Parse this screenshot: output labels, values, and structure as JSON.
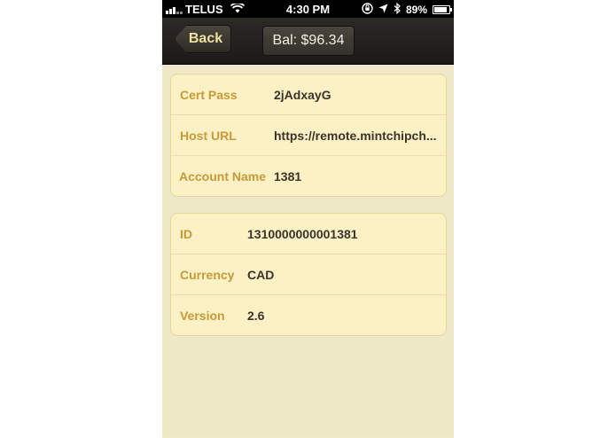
{
  "status_bar": {
    "carrier": "TELUS",
    "time": "4:30 PM",
    "battery": "89%"
  },
  "navbar": {
    "back_label": "Back",
    "balance": "Bal: $96.34"
  },
  "group_one": {
    "rows": [
      {
        "label": "Cert Pass",
        "value": "2jAdxayG"
      },
      {
        "label": "Host URL",
        "value": "https://remote.mintchipch..."
      },
      {
        "label": "Account Name",
        "value": "1381"
      }
    ]
  },
  "group_two": {
    "rows": [
      {
        "label": "ID",
        "value": "1310000000001381"
      },
      {
        "label": "Currency",
        "value": "CAD"
      },
      {
        "label": "Version",
        "value": "2.6"
      }
    ]
  },
  "colors": {
    "background": "#efe8c6",
    "cell": "#fbf1c4",
    "label": "#c79a3a",
    "value": "#3a3329",
    "navbar": "#2c2a26"
  }
}
